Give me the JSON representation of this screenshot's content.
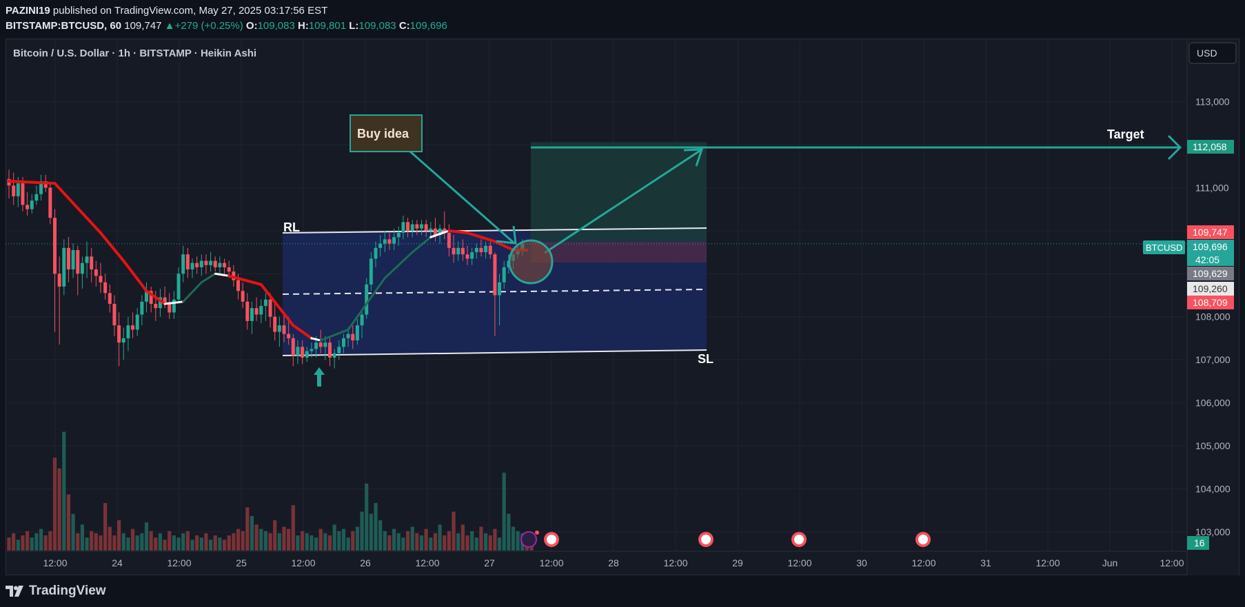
{
  "header": {
    "author": "PAZINI19",
    "published": "published on TradingView.com, May 27, 2025 03:17:56 EST",
    "symbol_line": "BITSTAMP:BTCUSD, 60",
    "last": "109,747",
    "change": "+279 (+0.25%)",
    "o_label": "O:",
    "o": "109,083",
    "h_label": "H:",
    "h": "109,801",
    "l_label": "L:",
    "l": "109,083",
    "c_label": "C:",
    "c": "109,696"
  },
  "chart_title": "Bitcoin / U.S. Dollar · 1h · BITSTAMP · Heikin Ashi",
  "currency_button": "USD",
  "footer": {
    "logo_text": "TradingView"
  },
  "colors": {
    "up": "#22ab94",
    "down": "#f7525f",
    "accent": "#26a69a",
    "ma_red": "#e61313",
    "ma_green": "#1d6b55",
    "zone_blue": "#1b2a63",
    "target_zone": "#1a3b39",
    "pink_zone": "#4a2a49"
  },
  "chart_data": {
    "type": "candlestick",
    "y_ticks": [
      103000,
      104000,
      105000,
      106000,
      107000,
      108000,
      109000,
      110000,
      111000,
      112000,
      113000
    ],
    "y_tick_labels": [
      "103,000",
      "104,000",
      "105,000",
      "106,000",
      "107,000",
      "108,000",
      "109,000",
      "110,000",
      "111,000",
      "112,000",
      "113,000"
    ],
    "ylim": [
      102550,
      114450
    ],
    "x_ticks": [
      "12:00",
      "24",
      "12:00",
      "25",
      "12:00",
      "26",
      "12:00",
      "27",
      "12:00",
      "28",
      "12:00",
      "29",
      "12:00",
      "30",
      "12:00",
      "31",
      "12:00",
      "Jun",
      "12:00"
    ],
    "price_labels": [
      {
        "value": 112058,
        "text": "112,058",
        "kind": "target"
      },
      {
        "value": 109747,
        "text": "109,747",
        "kind": "high-red"
      },
      {
        "value": 109696,
        "text": "109,696",
        "kind": "last"
      },
      {
        "value": 109629,
        "text": "109,629",
        "kind": "gray"
      },
      {
        "value": 109260,
        "text": "109,260",
        "kind": "white"
      },
      {
        "value": 108709,
        "text": "108,709",
        "kind": "low-red"
      }
    ],
    "countdown": "42:05",
    "symbol_tag": "BTCUSD",
    "volume_tag": "16",
    "annotations": {
      "buy_idea": "Buy idea",
      "target": "Target",
      "rl": "RL",
      "sl": "SL"
    },
    "candles": [
      {
        "o": 111200,
        "h": 111420,
        "l": 110750,
        "c": 111050
      },
      {
        "o": 111050,
        "h": 111350,
        "l": 110600,
        "c": 110800
      },
      {
        "o": 110800,
        "h": 111250,
        "l": 110550,
        "c": 111100
      },
      {
        "o": 111100,
        "h": 111250,
        "l": 110450,
        "c": 110600
      },
      {
        "o": 110600,
        "h": 110900,
        "l": 110350,
        "c": 110500
      },
      {
        "o": 110500,
        "h": 110850,
        "l": 110400,
        "c": 110700
      },
      {
        "o": 110700,
        "h": 111050,
        "l": 110600,
        "c": 110850
      },
      {
        "o": 110850,
        "h": 111300,
        "l": 110700,
        "c": 111150
      },
      {
        "o": 111150,
        "h": 111300,
        "l": 110900,
        "c": 111000
      },
      {
        "o": 111000,
        "h": 111100,
        "l": 110150,
        "c": 110300
      },
      {
        "o": 110300,
        "h": 110500,
        "l": 107650,
        "c": 109000
      },
      {
        "o": 109000,
        "h": 109400,
        "l": 107350,
        "c": 108700
      },
      {
        "o": 108700,
        "h": 109800,
        "l": 108500,
        "c": 109600
      },
      {
        "o": 109600,
        "h": 109850,
        "l": 108800,
        "c": 109100
      },
      {
        "o": 109100,
        "h": 109700,
        "l": 108900,
        "c": 109550
      },
      {
        "o": 109550,
        "h": 109650,
        "l": 108500,
        "c": 109000
      },
      {
        "o": 109000,
        "h": 109400,
        "l": 108650,
        "c": 109250
      },
      {
        "o": 109250,
        "h": 109750,
        "l": 108900,
        "c": 109400
      },
      {
        "o": 109400,
        "h": 109600,
        "l": 108800,
        "c": 109100
      },
      {
        "o": 109100,
        "h": 109300,
        "l": 108700,
        "c": 108950
      },
      {
        "o": 108950,
        "h": 109250,
        "l": 108550,
        "c": 108800
      },
      {
        "o": 108800,
        "h": 109000,
        "l": 108400,
        "c": 108550
      },
      {
        "o": 108550,
        "h": 108750,
        "l": 108100,
        "c": 108300
      },
      {
        "o": 108300,
        "h": 108500,
        "l": 107550,
        "c": 107800
      },
      {
        "o": 107800,
        "h": 108100,
        "l": 106850,
        "c": 107400
      },
      {
        "o": 107400,
        "h": 107750,
        "l": 107000,
        "c": 107500
      },
      {
        "o": 107500,
        "h": 108000,
        "l": 107200,
        "c": 107800
      },
      {
        "o": 107800,
        "h": 108100,
        "l": 107500,
        "c": 107700
      },
      {
        "o": 107700,
        "h": 108200,
        "l": 107550,
        "c": 108050
      },
      {
        "o": 108050,
        "h": 108500,
        "l": 107800,
        "c": 108350
      },
      {
        "o": 108350,
        "h": 108800,
        "l": 108100,
        "c": 108600
      },
      {
        "o": 108600,
        "h": 108700,
        "l": 108100,
        "c": 108300
      },
      {
        "o": 108300,
        "h": 108600,
        "l": 107900,
        "c": 108200
      },
      {
        "o": 108200,
        "h": 108650,
        "l": 108000,
        "c": 108450
      },
      {
        "o": 108450,
        "h": 108700,
        "l": 108200,
        "c": 108300
      },
      {
        "o": 108300,
        "h": 108550,
        "l": 107950,
        "c": 108100
      },
      {
        "o": 108100,
        "h": 108600,
        "l": 107950,
        "c": 108400
      },
      {
        "o": 108400,
        "h": 109150,
        "l": 108300,
        "c": 109000
      },
      {
        "o": 109000,
        "h": 109650,
        "l": 108800,
        "c": 109450
      },
      {
        "o": 109450,
        "h": 109600,
        "l": 108900,
        "c": 109100
      },
      {
        "o": 109100,
        "h": 109350,
        "l": 108900,
        "c": 109250
      },
      {
        "o": 109250,
        "h": 109400,
        "l": 109000,
        "c": 109150
      },
      {
        "o": 109150,
        "h": 109450,
        "l": 108950,
        "c": 109300
      },
      {
        "o": 109300,
        "h": 109450,
        "l": 109000,
        "c": 109200
      },
      {
        "o": 109200,
        "h": 109500,
        "l": 109050,
        "c": 109300
      },
      {
        "o": 109300,
        "h": 109400,
        "l": 109050,
        "c": 109150
      },
      {
        "o": 109150,
        "h": 109400,
        "l": 109000,
        "c": 109250
      },
      {
        "o": 109250,
        "h": 109350,
        "l": 109000,
        "c": 109150
      },
      {
        "o": 109150,
        "h": 109300,
        "l": 108900,
        "c": 109050
      },
      {
        "o": 109050,
        "h": 109200,
        "l": 108700,
        "c": 108850
      },
      {
        "o": 108850,
        "h": 109000,
        "l": 108400,
        "c": 108600
      },
      {
        "o": 108600,
        "h": 108800,
        "l": 108200,
        "c": 108350
      },
      {
        "o": 108350,
        "h": 108550,
        "l": 107700,
        "c": 107900
      },
      {
        "o": 107900,
        "h": 108350,
        "l": 107600,
        "c": 108200
      },
      {
        "o": 108200,
        "h": 108450,
        "l": 107900,
        "c": 108050
      },
      {
        "o": 108050,
        "h": 108400,
        "l": 107850,
        "c": 108250
      },
      {
        "o": 108250,
        "h": 108550,
        "l": 107900,
        "c": 108400
      },
      {
        "o": 108400,
        "h": 108550,
        "l": 107750,
        "c": 108000
      },
      {
        "o": 108000,
        "h": 108300,
        "l": 107450,
        "c": 107650
      },
      {
        "o": 107650,
        "h": 108000,
        "l": 107300,
        "c": 107800
      },
      {
        "o": 107800,
        "h": 108050,
        "l": 107400,
        "c": 107600
      },
      {
        "o": 107600,
        "h": 108000,
        "l": 107350,
        "c": 107500
      },
      {
        "o": 107500,
        "h": 107600,
        "l": 106850,
        "c": 107100
      },
      {
        "o": 107100,
        "h": 107450,
        "l": 106900,
        "c": 107300
      },
      {
        "o": 107300,
        "h": 107450,
        "l": 106900,
        "c": 107050
      },
      {
        "o": 107050,
        "h": 107300,
        "l": 106950,
        "c": 107200
      },
      {
        "o": 107200,
        "h": 107400,
        "l": 107050,
        "c": 107250
      },
      {
        "o": 107250,
        "h": 107550,
        "l": 107050,
        "c": 107400
      },
      {
        "o": 107400,
        "h": 107700,
        "l": 107150,
        "c": 107300
      },
      {
        "o": 107300,
        "h": 107550,
        "l": 107000,
        "c": 107400
      },
      {
        "o": 107400,
        "h": 107500,
        "l": 106850,
        "c": 107050
      },
      {
        "o": 107050,
        "h": 107250,
        "l": 106800,
        "c": 107150
      },
      {
        "o": 107150,
        "h": 107450,
        "l": 107000,
        "c": 107300
      },
      {
        "o": 107300,
        "h": 107600,
        "l": 107150,
        "c": 107500
      },
      {
        "o": 107500,
        "h": 107750,
        "l": 107300,
        "c": 107600
      },
      {
        "o": 107600,
        "h": 107800,
        "l": 107250,
        "c": 107450
      },
      {
        "o": 107450,
        "h": 107950,
        "l": 107350,
        "c": 107800
      },
      {
        "o": 107800,
        "h": 108150,
        "l": 107500,
        "c": 108050
      },
      {
        "o": 108050,
        "h": 108900,
        "l": 107950,
        "c": 108750
      },
      {
        "o": 108750,
        "h": 109500,
        "l": 108600,
        "c": 109350
      },
      {
        "o": 109350,
        "h": 109750,
        "l": 109150,
        "c": 109600
      },
      {
        "o": 109600,
        "h": 109900,
        "l": 109400,
        "c": 109700
      },
      {
        "o": 109700,
        "h": 110000,
        "l": 109500,
        "c": 109800
      },
      {
        "o": 109800,
        "h": 109950,
        "l": 109550,
        "c": 109700
      },
      {
        "o": 109700,
        "h": 110050,
        "l": 109550,
        "c": 109850
      },
      {
        "o": 109850,
        "h": 110100,
        "l": 109650,
        "c": 109950
      },
      {
        "o": 109950,
        "h": 110350,
        "l": 109800,
        "c": 110200
      },
      {
        "o": 110200,
        "h": 110300,
        "l": 109850,
        "c": 110000
      },
      {
        "o": 110000,
        "h": 110250,
        "l": 109850,
        "c": 110150
      },
      {
        "o": 110150,
        "h": 110250,
        "l": 109900,
        "c": 110050
      },
      {
        "o": 110050,
        "h": 110250,
        "l": 109900,
        "c": 110150
      },
      {
        "o": 110150,
        "h": 110250,
        "l": 109850,
        "c": 110000
      },
      {
        "o": 110000,
        "h": 110200,
        "l": 109850,
        "c": 110050
      },
      {
        "o": 110050,
        "h": 110300,
        "l": 109750,
        "c": 109900
      },
      {
        "o": 109900,
        "h": 110150,
        "l": 109700,
        "c": 110050
      },
      {
        "o": 110050,
        "h": 110450,
        "l": 109800,
        "c": 109950
      },
      {
        "o": 109950,
        "h": 110150,
        "l": 109400,
        "c": 109600
      },
      {
        "o": 109600,
        "h": 109900,
        "l": 109250,
        "c": 109450
      },
      {
        "o": 109450,
        "h": 109750,
        "l": 109300,
        "c": 109600
      },
      {
        "o": 109600,
        "h": 109800,
        "l": 109300,
        "c": 109450
      },
      {
        "o": 109450,
        "h": 109650,
        "l": 109200,
        "c": 109350
      },
      {
        "o": 109350,
        "h": 109600,
        "l": 109200,
        "c": 109500
      },
      {
        "o": 109500,
        "h": 109700,
        "l": 109350,
        "c": 109600
      },
      {
        "o": 109600,
        "h": 109800,
        "l": 109400,
        "c": 109500
      },
      {
        "o": 109500,
        "h": 109750,
        "l": 109350,
        "c": 109650
      },
      {
        "o": 109650,
        "h": 109750,
        "l": 109350,
        "c": 109450
      },
      {
        "o": 109450,
        "h": 109500,
        "l": 107550,
        "c": 108500
      },
      {
        "o": 108500,
        "h": 109000,
        "l": 107800,
        "c": 108800
      },
      {
        "o": 108800,
        "h": 109300,
        "l": 108650,
        "c": 109150
      },
      {
        "o": 109150,
        "h": 109450,
        "l": 109000,
        "c": 109300
      },
      {
        "o": 109300,
        "h": 109550,
        "l": 109100,
        "c": 109450
      },
      {
        "o": 109450,
        "h": 109650,
        "l": 109350,
        "c": 109550
      },
      {
        "o": 109550,
        "h": 109801,
        "l": 109400,
        "c": 109700
      }
    ],
    "volume": [
      6,
      8,
      5,
      7,
      9,
      6,
      8,
      10,
      7,
      9,
      43,
      38,
      55,
      26,
      17,
      8,
      12,
      6,
      9,
      8,
      7,
      22,
      11,
      7,
      14,
      8,
      6,
      10,
      7,
      8,
      13,
      9,
      6,
      8,
      5,
      9,
      7,
      6,
      8,
      9,
      5,
      7,
      6,
      8,
      5,
      7,
      6,
      5,
      7,
      8,
      10,
      9,
      20,
      16,
      12,
      10,
      9,
      8,
      14,
      8,
      11,
      10,
      21,
      7,
      9,
      8,
      7,
      6,
      10,
      8,
      7,
      12,
      9,
      10,
      6,
      9,
      11,
      18,
      31,
      17,
      22,
      14,
      9,
      7,
      10,
      8,
      6,
      9,
      11,
      8,
      7,
      10,
      6,
      8,
      12,
      7,
      9,
      18,
      8,
      12,
      7,
      9,
      6,
      11,
      8,
      7,
      10,
      6,
      36,
      17,
      11,
      9,
      8,
      7,
      6
    ],
    "volume_ylim": [
      0,
      60
    ],
    "moving_average": [
      {
        "x": 0,
        "y": 111150,
        "c": "red"
      },
      {
        "x": 10,
        "y": 111100,
        "c": "red"
      },
      {
        "x": 20,
        "y": 109950,
        "c": "red"
      },
      {
        "x": 25,
        "y": 109300,
        "c": "red"
      },
      {
        "x": 30,
        "y": 108600,
        "c": "red"
      },
      {
        "x": 34,
        "y": 108300,
        "c": "white"
      },
      {
        "x": 38,
        "y": 108350,
        "c": "green"
      },
      {
        "x": 42,
        "y": 108800,
        "c": "green"
      },
      {
        "x": 45,
        "y": 109000,
        "c": "white"
      },
      {
        "x": 48,
        "y": 108950,
        "c": "red"
      },
      {
        "x": 55,
        "y": 108750,
        "c": "red"
      },
      {
        "x": 62,
        "y": 107800,
        "c": "red"
      },
      {
        "x": 66,
        "y": 107500,
        "c": "white"
      },
      {
        "x": 68,
        "y": 107450,
        "c": "green"
      },
      {
        "x": 74,
        "y": 107700,
        "c": "green"
      },
      {
        "x": 82,
        "y": 108900,
        "c": "green"
      },
      {
        "x": 88,
        "y": 109500,
        "c": "green"
      },
      {
        "x": 92,
        "y": 109850,
        "c": "white"
      },
      {
        "x": 96,
        "y": 110000,
        "c": "red"
      },
      {
        "x": 100,
        "y": 109950,
        "c": "red"
      },
      {
        "x": 106,
        "y": 109750,
        "c": "red"
      },
      {
        "x": 110,
        "y": 109550,
        "c": "red"
      },
      {
        "x": 113,
        "y": 109550,
        "c": "white"
      }
    ]
  }
}
